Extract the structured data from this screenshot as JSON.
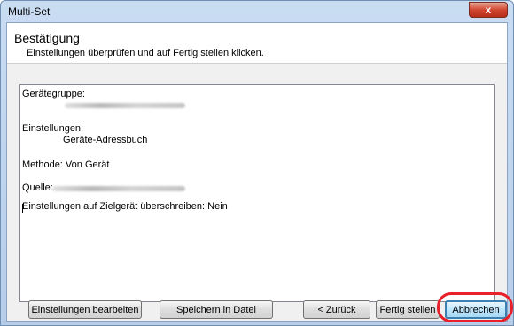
{
  "window": {
    "title": "Multi-Set",
    "close_label": "x"
  },
  "header": {
    "title": "Bestätigung",
    "subtitle": "Einstellungen überprüfen und auf Fertig stellen klicken."
  },
  "summary": {
    "group_label": "Gerätegruppe:",
    "settings_label": "Einstellungen:",
    "settings_value": "Geräte-Adressbuch",
    "method": "Methode: Von Gerät",
    "source_label": "Quelle:",
    "overwrite": "Einstellungen auf Zielgerät überschreiben: Nein"
  },
  "buttons": {
    "edit": "Einstellungen bearbeiten",
    "save": "Speichern in Datei",
    "back": "< Zurück",
    "finish": "Fertig stellen",
    "cancel": "Abbrechen"
  },
  "colors": {
    "highlight": "#e8202a",
    "accent": "#3c7fb1"
  }
}
